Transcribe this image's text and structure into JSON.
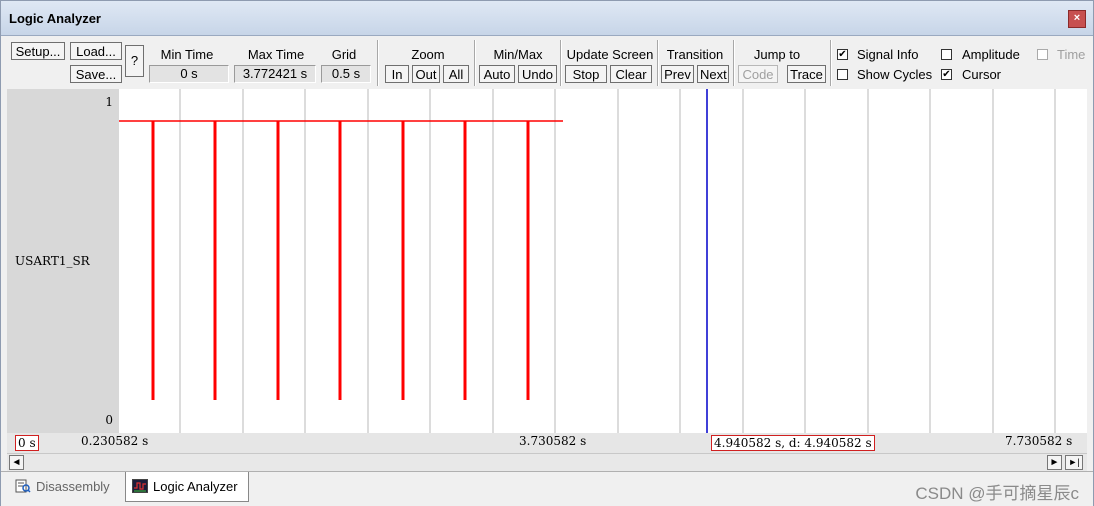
{
  "window": {
    "title": "Logic Analyzer",
    "close_glyph": "×"
  },
  "toolbar": {
    "setup_label": "Setup...",
    "load_label": "Load...",
    "save_label": "Save...",
    "help_label": "?",
    "min_time": {
      "label": "Min Time",
      "value": "0 s"
    },
    "max_time": {
      "label": "Max Time",
      "value": "3.772421 s"
    },
    "grid": {
      "label": "Grid",
      "value": "0.5 s"
    },
    "zoom": {
      "label": "Zoom",
      "in": "In",
      "out": "Out",
      "all": "All"
    },
    "minmax": {
      "label": "Min/Max",
      "auto": "Auto",
      "undo": "Undo"
    },
    "update_screen": {
      "label": "Update Screen",
      "stop": "Stop",
      "clear": "Clear"
    },
    "transition": {
      "label": "Transition",
      "prev": "Prev",
      "next": "Next"
    },
    "jump_to": {
      "label": "Jump to",
      "code": "Code",
      "trace": "Trace"
    },
    "options": {
      "signal_info": {
        "label": "Signal Info",
        "checked": true
      },
      "show_cycles": {
        "label": "Show Cycles",
        "checked": false
      },
      "amplitude": {
        "label": "Amplitude",
        "checked": false
      },
      "cursor": {
        "label": "Cursor",
        "checked": true
      },
      "time": {
        "label": "Time",
        "checked": false,
        "disabled": true
      }
    }
  },
  "signal": {
    "name": "USART1_SR",
    "y_max_label": "1",
    "y_min_label": "0",
    "color": "#ff0000",
    "cursor_color": "#0000cc"
  },
  "timeline": {
    "left_boxed": "0 s",
    "start_label": "0.230582 s",
    "mid_label": "3.730582 s",
    "cursor_readout": "4.940582 s,  d: 4.940582 s",
    "right_label": "7.730582 s"
  },
  "scrollbar": {
    "left_glyph": "◄",
    "right_glyph": "►",
    "end_glyph": "►|"
  },
  "tabs": [
    {
      "label": "Disassembly",
      "active": false
    },
    {
      "label": "Logic Analyzer",
      "active": true
    }
  ],
  "watermark": "CSDN @手可摘星辰c"
}
